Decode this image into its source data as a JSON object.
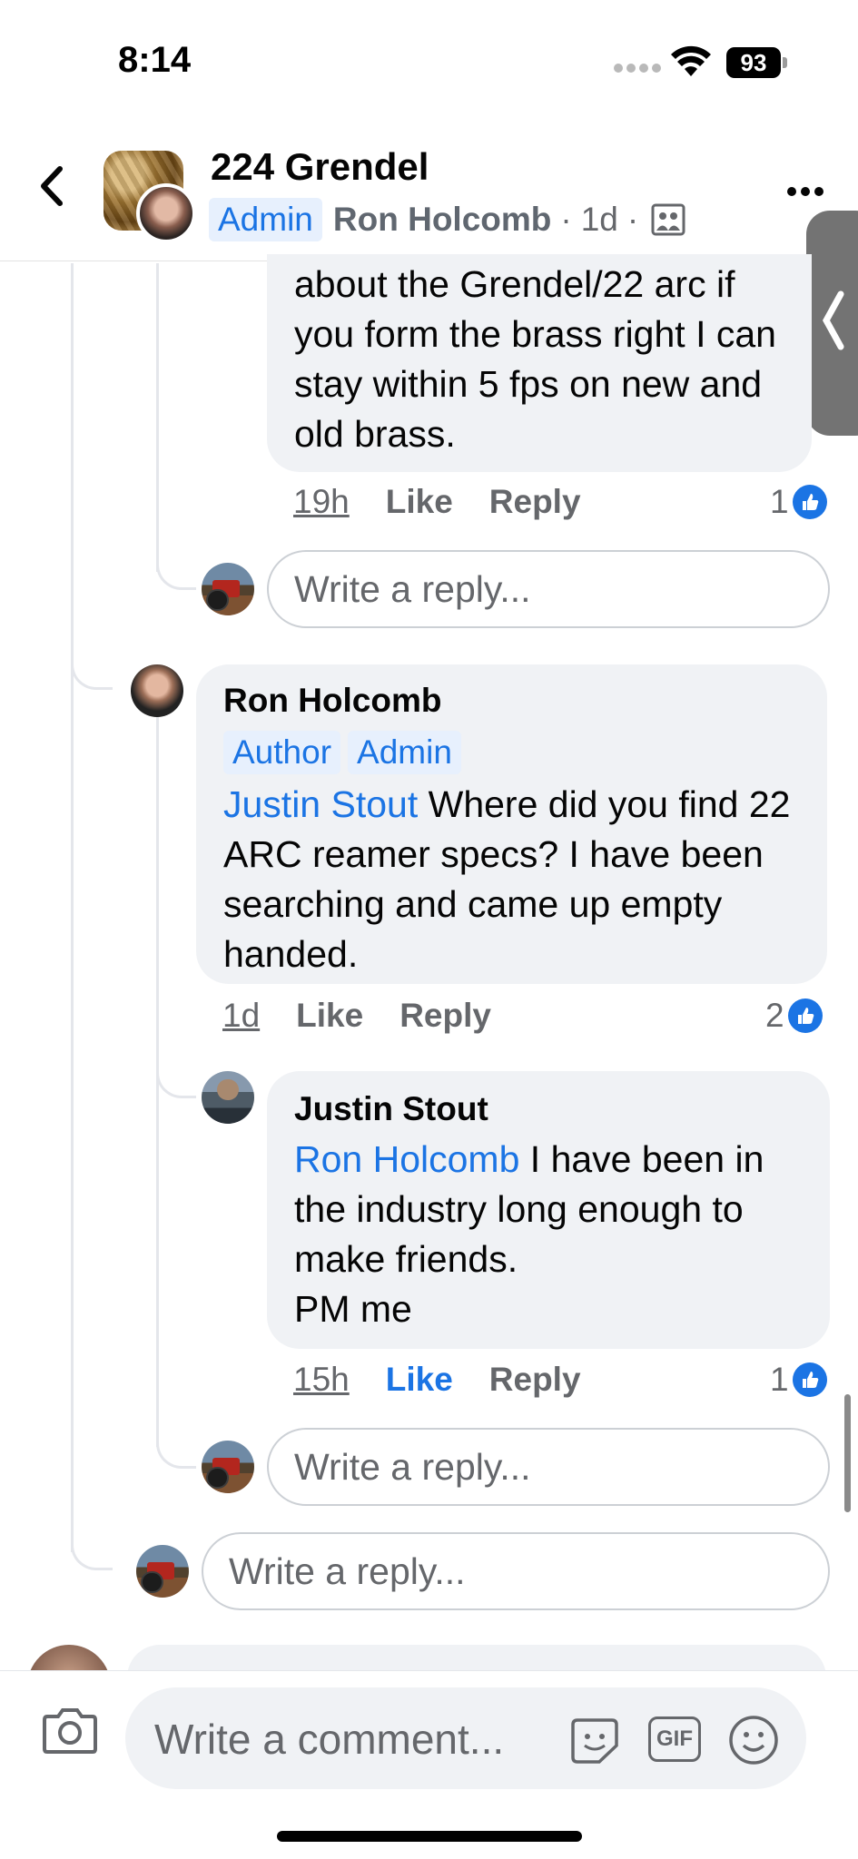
{
  "status_bar": {
    "time": "8:14",
    "battery": "93"
  },
  "header": {
    "title": "224 Grendel",
    "badge": "Admin",
    "author": "Ron Holcomb",
    "time": "1d",
    "separator": "·"
  },
  "comments": [
    {
      "text": "about the Grendel/22 arc if you form the brass right I can stay within 5 fps on new and old brass.",
      "time": "19h",
      "like": "Like",
      "reply": "Reply",
      "reactions": "1"
    },
    {
      "author": "Ron Holcomb",
      "badges": [
        "Author",
        "Admin"
      ],
      "mention": "Justin Stout",
      "text": " Where did you find 22 ARC reamer specs? I have been searching and came up empty handed.",
      "time": "1d",
      "like": "Like",
      "reply": "Reply",
      "reactions": "2"
    },
    {
      "author": "Justin Stout",
      "mention": "Ron Holcomb",
      "text": " I have been in the industry long enough to make friends.",
      "text2": "PM me",
      "time": "15h",
      "like": "Like",
      "reply": "Reply",
      "reactions": "1"
    }
  ],
  "reply_placeholder": "Write a reply...",
  "composer": {
    "placeholder": "Write a comment...",
    "gif": "GIF"
  },
  "colors": {
    "accent": "#1b74e4",
    "bubble": "#f0f2f5",
    "secondary_text": "#65676b"
  }
}
